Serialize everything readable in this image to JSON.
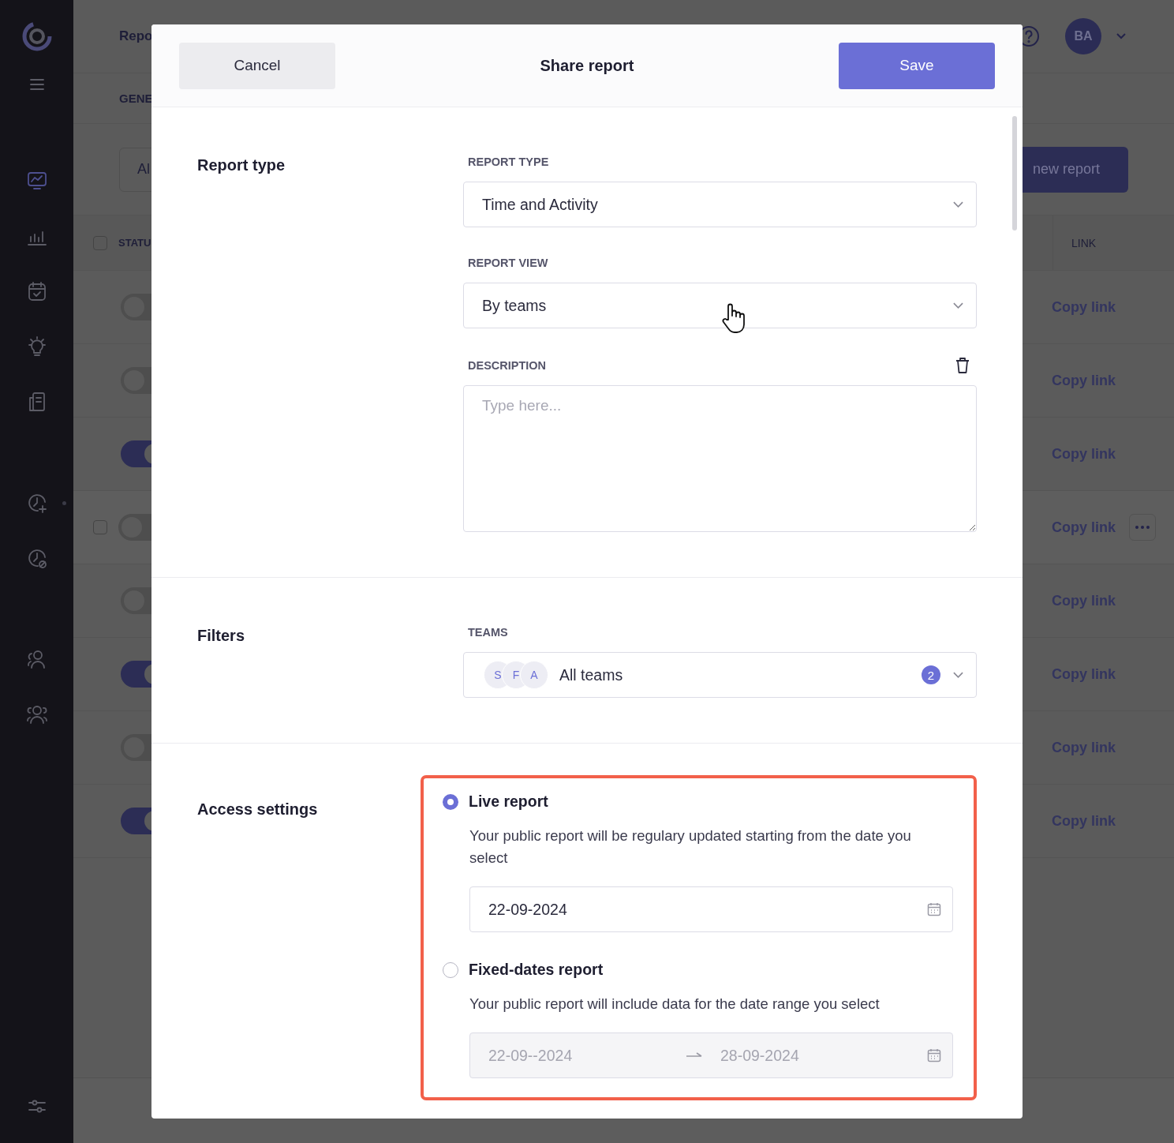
{
  "sidebar": {
    "items": [
      {
        "kind": "menu",
        "selected": false
      },
      {
        "kind": "monitor",
        "selected": true
      },
      {
        "kind": "chart",
        "selected": false
      },
      {
        "kind": "calendar",
        "selected": false
      },
      {
        "kind": "bulb",
        "selected": false
      },
      {
        "kind": "document",
        "selected": false
      },
      {
        "kind": "clock-plus",
        "selected": false
      },
      {
        "kind": "clock-off",
        "selected": false
      },
      {
        "kind": "user",
        "selected": false
      },
      {
        "kind": "users",
        "selected": false
      }
    ]
  },
  "header": {
    "title": "Repo",
    "avatar_initials": "BA"
  },
  "tab_label": "GENE",
  "filter_field": {
    "value": "Al"
  },
  "new_report_button": "new report",
  "table": {
    "columns": [
      "STATU",
      "LINK"
    ],
    "select_all_checked": false,
    "rows": [
      {
        "on": false,
        "hovered": false,
        "link": "Copy link"
      },
      {
        "on": false,
        "hovered": false,
        "link": "Copy link"
      },
      {
        "on": true,
        "hovered": false,
        "link": "Copy link"
      },
      {
        "on": false,
        "hovered": true,
        "checked": false,
        "link": "Copy link"
      },
      {
        "on": false,
        "hovered": false,
        "link": "Copy link"
      },
      {
        "on": true,
        "hovered": false,
        "link": "Copy link"
      },
      {
        "on": false,
        "hovered": false,
        "link": "Copy link"
      },
      {
        "on": true,
        "hovered": false,
        "link": "Copy link"
      }
    ]
  },
  "modal": {
    "cancel": "Cancel",
    "title": "Share report",
    "save": "Save"
  },
  "report_type_section": {
    "heading": "Report type",
    "type_label": "REPORT TYPE",
    "type_value": "Time and Activity",
    "view_label": "REPORT VIEW",
    "view_value": "By teams",
    "description_label": "DESCRIPTION",
    "description_placeholder": "Type here..."
  },
  "filters": {
    "heading": "Filters",
    "teams_label": "TEAMS",
    "avatars": [
      "S",
      "F",
      "A"
    ],
    "teams_value": "All teams",
    "count": "2"
  },
  "access": {
    "heading": "Access settings",
    "options": [
      {
        "kind": "live",
        "label": "Live report",
        "selected": true,
        "description": "Your public report will be regulary updated starting from the date you select",
        "date": "22-09-2024"
      },
      {
        "kind": "fixed",
        "label": "Fixed-dates report",
        "selected": false,
        "description": "Your public report will include data for the date range you select",
        "start": "22-09--2024",
        "end": "28-09-2024"
      }
    ]
  }
}
